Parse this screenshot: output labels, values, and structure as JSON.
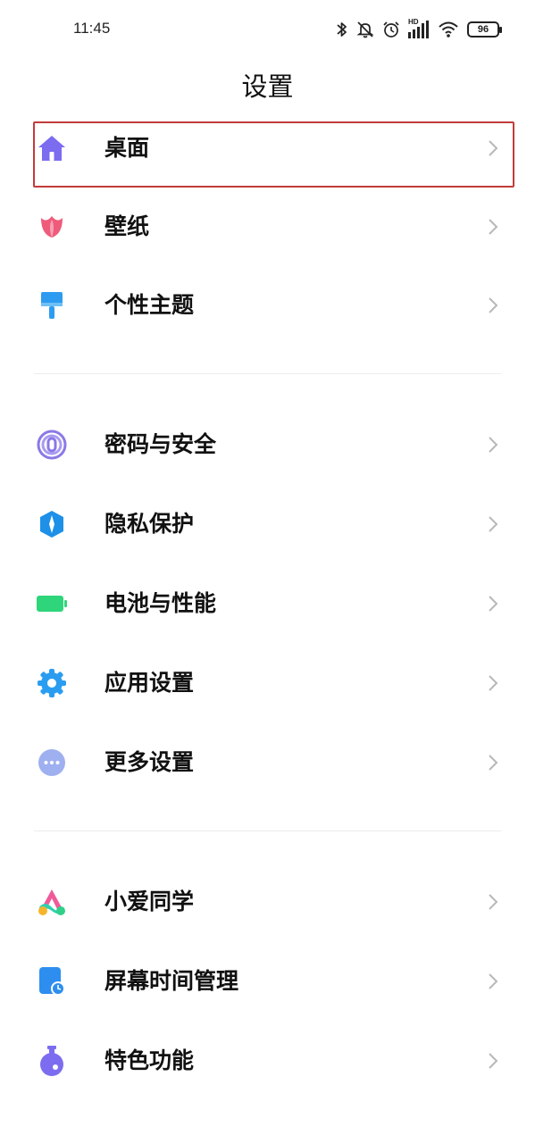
{
  "status_bar": {
    "time": "11:45",
    "network_label": "HD",
    "battery": "96",
    "icons": [
      "bluetooth-icon",
      "mute-icon",
      "alarm-icon",
      "signal-icon",
      "wifi-icon",
      "battery-icon"
    ]
  },
  "header": {
    "title": "设置"
  },
  "groups": [
    {
      "items": [
        {
          "label": "桌面",
          "icon": "home-icon",
          "color": "#7b6cf0"
        },
        {
          "label": "壁纸",
          "icon": "tulip-icon",
          "color": "#ef5b7a"
        },
        {
          "label": "个性主题",
          "icon": "paint-brush-icon",
          "color": "#2d9cf0"
        }
      ]
    },
    {
      "items": [
        {
          "label": "密码与安全",
          "icon": "fingerprint-icon",
          "color": "#8a79e6"
        },
        {
          "label": "隐私保护",
          "icon": "privacy-shield-icon",
          "color": "#1e90e8"
        },
        {
          "label": "电池与性能",
          "icon": "battery-icon",
          "color": "#2fd57a"
        },
        {
          "label": "应用设置",
          "icon": "gear-icon",
          "color": "#2a9df0"
        },
        {
          "label": "更多设置",
          "icon": "more-icon",
          "color": "#9fb0f0"
        }
      ]
    },
    {
      "items": [
        {
          "label": "小爱同学",
          "icon": "xiaoai-icon",
          "color": "#f05a9a"
        },
        {
          "label": "屏幕时间管理",
          "icon": "screen-time-icon",
          "color": "#2d8ef0"
        },
        {
          "label": "特色功能",
          "icon": "flask-icon",
          "color": "#7c6df0"
        }
      ]
    }
  ],
  "selected_item": "桌面"
}
